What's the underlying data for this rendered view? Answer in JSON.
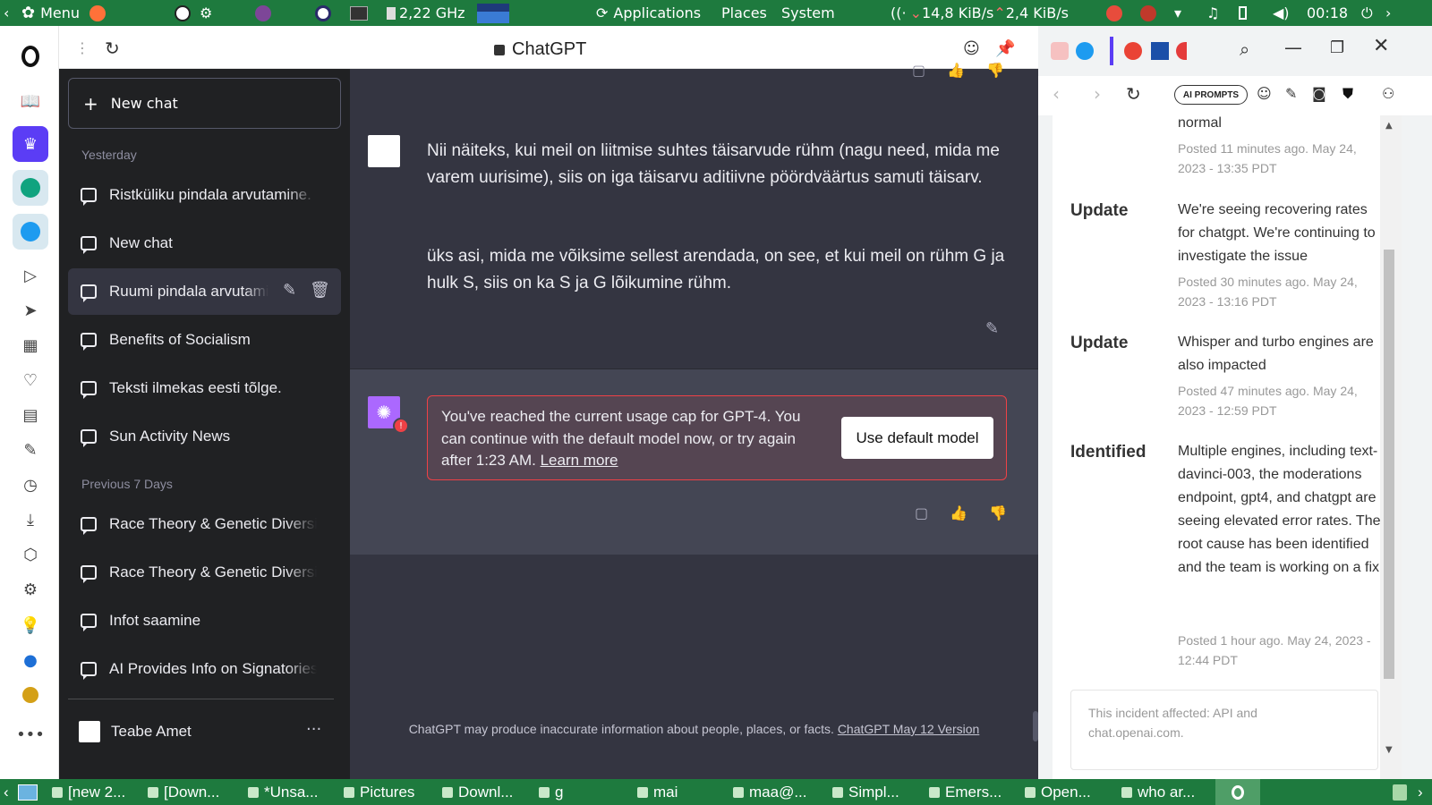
{
  "top_panel": {
    "menu": "Menu",
    "cpu_freq": "2,22 GHz",
    "applications": "Applications",
    "places": "Places",
    "system": "System",
    "net_down": "14,8 KiB/s",
    "net_up": "2,4 KiB/s",
    "clock": "00:18"
  },
  "browser": {
    "tab_title": "ChatGPT"
  },
  "sidebar": {
    "new_chat": "New chat",
    "sections": [
      {
        "title": "Yesterday"
      },
      {
        "title": "Previous 7 Days"
      }
    ],
    "conversations": [
      "Ristküliku pindala arvutamine.",
      "New chat",
      "Ruumi pindala arvutamine",
      "Benefits of Socialism",
      "Teksti ilmekas eesti tõlge.",
      "Sun Activity News",
      "Race Theory & Genetic Diversity",
      "Race Theory & Genetic Diversity",
      "Infot saamine",
      "AI Provides Info on Signatories"
    ],
    "user_name": "Teabe Amet"
  },
  "chat": {
    "user_message_p1": "Nii näiteks, kui meil on liitmise suhtes täisarvude rühm (nagu need, mida me varem uurisime), siis on iga täisarvu aditiivne pöördväärtus samuti täisarv.",
    "user_message_p2": "üks asi, mida me võiksime sellest arendada, on see, et kui meil on rühm G ja hulk S, siis on ka S ja G lõikumine rühm.",
    "cap_text": "You've reached the current usage cap for GPT-4. You can continue with the default model now, or try again after 1:23 AM.",
    "learn_more": "Learn more",
    "use_default": "Use default model",
    "footer_text": "ChatGPT may produce inaccurate information about people, places, or facts.",
    "footer_link": "ChatGPT May 12 Version"
  },
  "right_panel": {
    "ai_prompts": "AI PROMPTS",
    "top_cut_text": "normal",
    "top_cut_date": "Posted 11 minutes ago. May 24, 2023 - 13:35 PDT",
    "updates": [
      {
        "status": "Update",
        "body": "We're seeing recovering rates for chatgpt.  We're continuing to investigate the issue",
        "date": "Posted 30 minutes ago. May 24, 2023 - 13:16 PDT"
      },
      {
        "status": "Update",
        "body": "Whisper and turbo engines are also impacted",
        "date": "Posted 47 minutes ago. May 24, 2023 - 12:59 PDT"
      },
      {
        "status": "Identified",
        "body": "Multiple engines, including text-davinci-003, the moderations endpoint, gpt4, and chatgpt are seeing elevated error rates. The root cause has been identified and the team is working on a fix.",
        "date": "Posted 1 hour ago. May 24, 2023 - 12:44 PDT"
      }
    ],
    "affected": "This incident affected: API and chat.openai.com."
  },
  "taskbar": {
    "items": [
      "[new 2...",
      "[Down...",
      "*Unsa...",
      "Pictures",
      "Downl...",
      "g",
      "mai",
      "maa@...",
      "Simpl...",
      "Emers...",
      "Open...",
      "who ar..."
    ]
  },
  "colors": {
    "panel_green": "#1e7a3e",
    "sidebar_bg": "#202123",
    "main_bg": "#343541",
    "assistant_bg": "#444654",
    "gpt4_purple": "#ab68ff",
    "error_red": "#ef4146"
  }
}
